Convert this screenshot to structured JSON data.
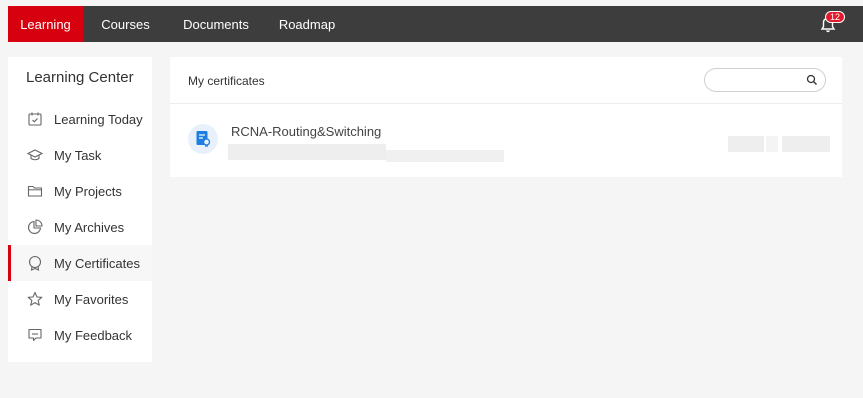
{
  "topnav": {
    "items": [
      {
        "label": "Learning",
        "active": true
      },
      {
        "label": "Courses",
        "active": false
      },
      {
        "label": "Documents",
        "active": false
      },
      {
        "label": "Roadmap",
        "active": false
      }
    ],
    "notification_count": "12",
    "accent_color": "#d7000f",
    "bar_color": "#3d3d3d",
    "notification_icon": "bell-icon"
  },
  "sidebar": {
    "title": "Learning Center",
    "items": [
      {
        "label": "Learning Today",
        "icon": "calendar-icon",
        "active": false
      },
      {
        "label": "My Task",
        "icon": "graduation-cap-icon",
        "active": false
      },
      {
        "label": "My Projects",
        "icon": "folder-icon",
        "active": false
      },
      {
        "label": "My Archives",
        "icon": "pie-chart-icon",
        "active": false
      },
      {
        "label": "My Certificates",
        "icon": "certificate-icon",
        "active": true
      },
      {
        "label": "My Favorites",
        "icon": "star-icon",
        "active": false
      },
      {
        "label": "My Feedback",
        "icon": "feedback-icon",
        "active": false
      }
    ]
  },
  "main": {
    "title": "My certificates",
    "search": {
      "value": "",
      "placeholder": "",
      "icon": "search-icon"
    },
    "certificates": [
      {
        "name": "RCNA-Routing&Switching",
        "icon": "certificate-document-icon"
      }
    ]
  }
}
